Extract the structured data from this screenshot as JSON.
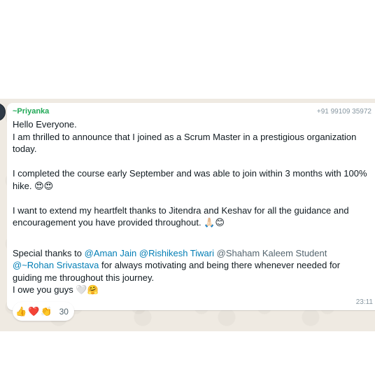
{
  "message": {
    "sender_name": "~Priyanka",
    "sender_phone": "+91 99109 35972",
    "line_greeting": "Hello Everyone.",
    "line_announce": "I am thrilled to announce that I joined as a Scrum Master in a prestigious organization today.",
    "line_course": "I completed the course early September and was able to join within 3 months with 100% hike.",
    "emoji_course": "😍😍",
    "line_thanks": "I want to extend my heartfelt thanks to Jitendra and Keshav for all the guidance and encouragement you have provided throughout.",
    "emoji_thanks": "🙏🏻😊",
    "special_prefix": "Special thanks to ",
    "mention_aman": "@Aman Jain",
    "mention_rishikesh": "@Rishikesh Tiwari",
    "mention_shaham": "@Shaham Kaleem Student",
    "mention_rohan": "@~Rohan Srivastava",
    "special_suffix": "  for always motivating and being there whenever needed for guiding me throughout this journey.",
    "line_owe": "I owe you guys",
    "emoji_owe": "🤍🤗",
    "time": "23:11"
  },
  "reactions": {
    "emojis": [
      "👍",
      "❤️",
      "👏"
    ],
    "count": "30"
  },
  "colors": {
    "sender_name": "#1fa855",
    "mention": "#027eb5",
    "chat_background": "#efeae2"
  }
}
